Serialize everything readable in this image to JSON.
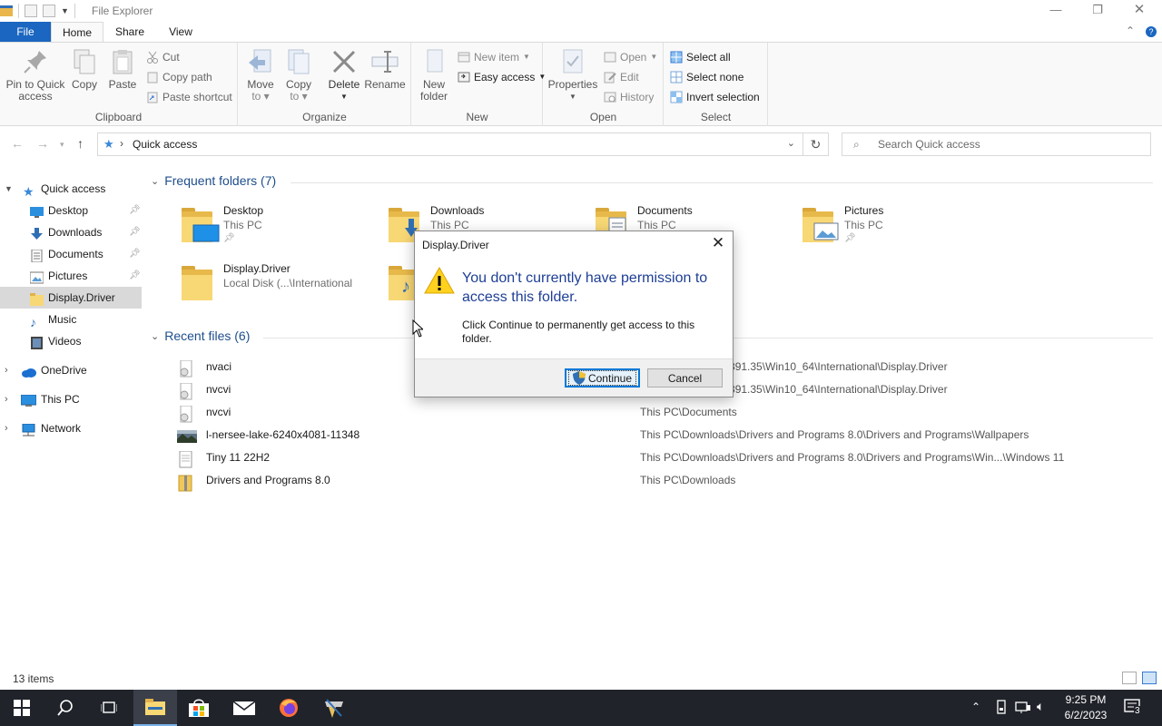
{
  "window": {
    "title": "File Explorer"
  },
  "ribbon": {
    "tabs": {
      "file": "File",
      "home": "Home",
      "share": "Share",
      "view": "View"
    },
    "clipboard": {
      "label": "Clipboard",
      "pin": "Pin to Quick access",
      "pin_l1": "Pin to Quick",
      "pin_l2": "access",
      "copy": "Copy",
      "paste": "Paste",
      "cut": "Cut",
      "copy_path": "Copy path",
      "paste_shortcut": "Paste shortcut"
    },
    "organize": {
      "label": "Organize",
      "move_l1": "Move",
      "move_l2": "to",
      "copy_l1": "Copy",
      "copy_l2": "to",
      "delete": "Delete",
      "rename": "Rename"
    },
    "new": {
      "label": "New",
      "folder_l1": "New",
      "folder_l2": "folder",
      "new_item": "New item",
      "easy_access": "Easy access"
    },
    "open": {
      "label": "Open",
      "properties": "Properties",
      "open": "Open",
      "edit": "Edit",
      "history": "History"
    },
    "select": {
      "label": "Select",
      "select_all": "Select all",
      "select_none": "Select none",
      "invert": "Invert selection"
    }
  },
  "navbar": {
    "address": "Quick access",
    "search_placeholder": "Search Quick access"
  },
  "sidebar": {
    "items": [
      {
        "label": "Quick access",
        "icon": "star-icon"
      },
      {
        "label": "Desktop",
        "icon": "desktop-icon"
      },
      {
        "label": "Downloads",
        "icon": "download-icon"
      },
      {
        "label": "Documents",
        "icon": "documents-icon"
      },
      {
        "label": "Pictures",
        "icon": "pictures-icon"
      },
      {
        "label": "Display.Driver",
        "icon": "folder-icon"
      },
      {
        "label": "Music",
        "icon": "music-icon"
      },
      {
        "label": "Videos",
        "icon": "videos-icon"
      },
      {
        "label": "OneDrive",
        "icon": "cloud-icon"
      },
      {
        "label": "This PC",
        "icon": "computer-icon"
      },
      {
        "label": "Network",
        "icon": "network-icon"
      }
    ]
  },
  "frequent": {
    "heading": "Frequent folders (7)",
    "folders": [
      {
        "name": "Desktop",
        "location": "This PC"
      },
      {
        "name": "Downloads",
        "location": "This PC"
      },
      {
        "name": "Documents",
        "location": "This PC"
      },
      {
        "name": "Pictures",
        "location": "This PC"
      },
      {
        "name": "Display.Driver",
        "location": "Local Disk (...\\International"
      }
    ]
  },
  "recent": {
    "heading": "Recent files (6)",
    "files": [
      {
        "name": "nvaci",
        "path": "DIA\\DisplayDriver\\391.35\\Win10_64\\International\\Display.Driver"
      },
      {
        "name": "nvcvi",
        "path": "DIA\\DisplayDriver\\391.35\\Win10_64\\International\\Display.Driver"
      },
      {
        "name": "nvcvi",
        "path": "This PC\\Documents"
      },
      {
        "name": "l-nersee-lake-6240x4081-11348",
        "path": "This PC\\Downloads\\Drivers and Programs 8.0\\Drivers and Programs\\Wallpapers"
      },
      {
        "name": "Tiny 11 22H2",
        "path": "This PC\\Downloads\\Drivers and Programs 8.0\\Drivers and Programs\\Win...\\Windows 11"
      },
      {
        "name": "Drivers and Programs 8.0",
        "path": "This PC\\Downloads"
      }
    ]
  },
  "status": {
    "count": "13 items"
  },
  "dialog": {
    "title": "Display.Driver",
    "message": "You don't currently have permission to access this folder.",
    "detail": "Click Continue to permanently get access to this folder.",
    "continue": "Continue",
    "cancel": "Cancel"
  },
  "taskbar": {
    "time": "9:25 PM",
    "date": "6/2/2023",
    "notifications": "3"
  },
  "colors": {
    "accent": "#1a66c0",
    "folder": "#f8d775",
    "dialog_message": "#1e3f95",
    "taskbar": "#20232a"
  }
}
